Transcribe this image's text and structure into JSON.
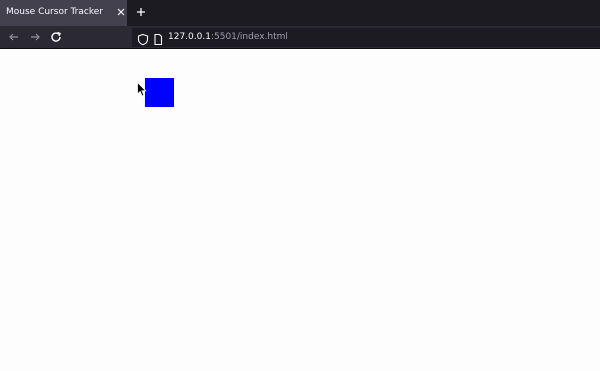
{
  "tab": {
    "title": "Mouse Cursor Tracker",
    "close_icon": "close-icon"
  },
  "toolbar": {
    "new_tab_icon": "plus-icon",
    "back_icon": "arrow-left-icon",
    "forward_icon": "arrow-right-icon",
    "reload_icon": "reload-icon"
  },
  "url": {
    "host": "127.0.0.1",
    "rest": ":5501/index.html"
  },
  "content": {
    "box_color": "#0000ff",
    "cursor_icon": "mouse-pointer-icon"
  },
  "colors": {
    "tab_strip": "#1c1b22",
    "active_tab": "#42414d",
    "nav_bar": "#2b2a33",
    "url_bar": "#1c1b22",
    "page_background": "#fdfdfd"
  }
}
